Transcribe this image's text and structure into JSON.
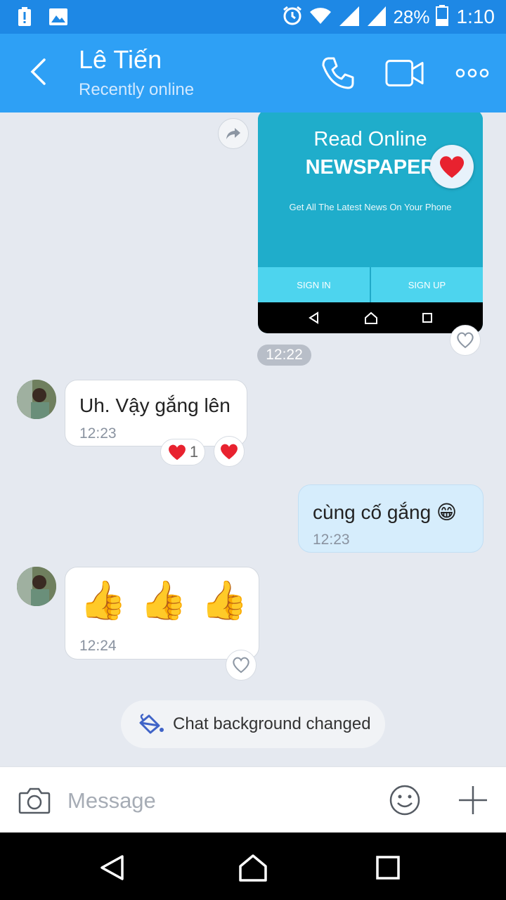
{
  "status_bar": {
    "battery_percent": "28%",
    "time": "1:10",
    "icons": [
      "alert-icon",
      "image-icon",
      "alarm-icon",
      "wifi-icon",
      "signal-icon",
      "signal-icon",
      "battery-icon"
    ]
  },
  "header": {
    "contact_name": "Lê Tiến",
    "contact_status": "Recently online",
    "icons": [
      "back-arrow-icon",
      "phone-icon",
      "video-camera-icon",
      "more-dots-icon"
    ]
  },
  "shared_image": {
    "title_line1": "Read Online",
    "title_line2": "NEWSPAPER",
    "subtitle": "Get All The Latest News On Your Phone",
    "button_left": "SIGN IN",
    "button_right": "SIGN UP"
  },
  "messages": [
    {
      "time_pill": "12:22"
    },
    {
      "direction": "in",
      "text": "Uh. Vậy gắng lên",
      "time": "12:23",
      "reaction_count": "1"
    },
    {
      "direction": "out",
      "text": "cùng cố gắng 😁",
      "time": "12:23"
    },
    {
      "direction": "in",
      "text": "👍 👍 👍",
      "time": "12:24"
    }
  ],
  "system_message": "Chat background changed",
  "input": {
    "placeholder": "Message",
    "value": ""
  },
  "colors": {
    "status_bar": "#1e88e5",
    "header": "#2ea0f5",
    "chat_bg": "#e5e9f0",
    "outgoing_bubble": "#d6edfc"
  }
}
